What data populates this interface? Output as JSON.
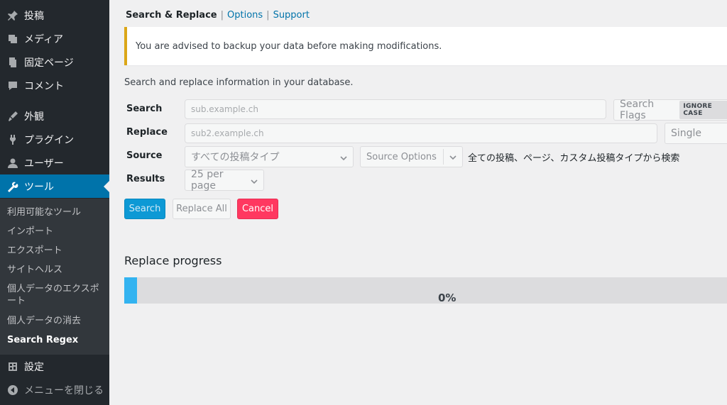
{
  "sidebar": {
    "items": [
      {
        "label": "投稿",
        "icon": "pin-icon"
      },
      {
        "label": "メディア",
        "icon": "media-icon"
      },
      {
        "label": "固定ページ",
        "icon": "pages-icon"
      },
      {
        "label": "コメント",
        "icon": "comment-icon"
      },
      {
        "label": "外観",
        "icon": "appearance-icon"
      },
      {
        "label": "プラグイン",
        "icon": "plugin-icon"
      },
      {
        "label": "ユーザー",
        "icon": "user-icon"
      },
      {
        "label": "ツール",
        "icon": "wrench-icon"
      },
      {
        "label": "設定",
        "icon": "settings-icon"
      },
      {
        "label": "メニューを閉じる",
        "icon": "collapse-icon"
      }
    ],
    "submenu": [
      "利用可能なツール",
      "インポート",
      "エクスポート",
      "サイトヘルス",
      "個人データのエクスポート",
      "個人データの消去",
      "Search Regex"
    ]
  },
  "tabs": {
    "current": "Search & Replace",
    "options": "Options",
    "support": "Support",
    "separator": "|"
  },
  "notice": "You are advised to backup your data before making modifications.",
  "description": "Search and replace information in your database.",
  "form": {
    "search_label": "Search",
    "search_value": "sub.example.ch",
    "search_flags": "Search Flags",
    "ignore_case": "IGNORE CASE",
    "replace_label": "Replace",
    "replace_value": "sub2.example.ch",
    "replace_mode": "Single",
    "source_label": "Source",
    "source_value": "すべての投稿タイプ",
    "source_options": "Source Options",
    "source_hint": "全ての投稿、ページ、カスタム投稿タイプから検索",
    "results_label": "Results",
    "results_value": "25 per page"
  },
  "buttons": {
    "search": "Search",
    "replace_all": "Replace All",
    "cancel": "Cancel"
  },
  "progress": {
    "title": "Replace progress",
    "percent_text": "0%",
    "fill_fraction": 0.021
  },
  "colors": {
    "accent": "#0073aa",
    "notice_border": "#dba617",
    "cancel": "#ff3860",
    "progress": "#33b3f0"
  }
}
